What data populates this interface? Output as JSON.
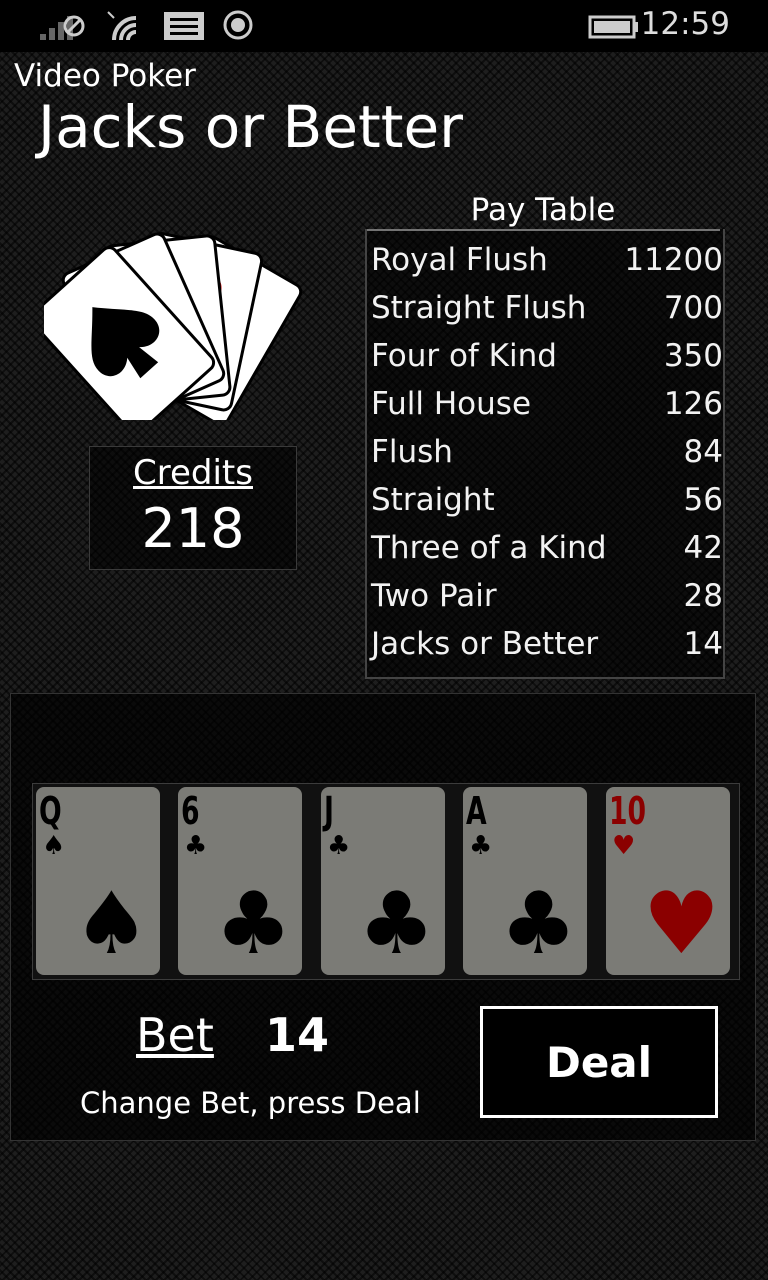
{
  "status": {
    "time": "12:59",
    "icons": [
      "signal-icon",
      "wifi-icon",
      "message-icon",
      "location-icon",
      "battery-icon"
    ]
  },
  "app": {
    "name": "Video Poker",
    "title": "Jacks or Better"
  },
  "credits": {
    "label": "Credits",
    "value": "218"
  },
  "paytable": {
    "title": "Pay Table",
    "rows": [
      {
        "hand": "Royal Flush",
        "payout": "11200"
      },
      {
        "hand": "Straight Flush",
        "payout": "700"
      },
      {
        "hand": "Four of Kind",
        "payout": "350"
      },
      {
        "hand": "Full House",
        "payout": "126"
      },
      {
        "hand": "Flush",
        "payout": "84"
      },
      {
        "hand": "Straight",
        "payout": "56"
      },
      {
        "hand": "Three of a Kind",
        "payout": "42"
      },
      {
        "hand": "Two Pair",
        "payout": "28"
      },
      {
        "hand": "Jacks or Better",
        "payout": "14"
      }
    ]
  },
  "hand": [
    {
      "rank": "Q",
      "suit": "♠",
      "color": "#000000"
    },
    {
      "rank": "6",
      "suit": "♣",
      "color": "#000000"
    },
    {
      "rank": "J",
      "suit": "♣",
      "color": "#000000"
    },
    {
      "rank": "A",
      "suit": "♣",
      "color": "#000000"
    },
    {
      "rank": "10",
      "suit": "♥",
      "color": "#8b0000"
    }
  ],
  "bet": {
    "label": "Bet",
    "value": "14",
    "hint": "Change Bet, press Deal"
  },
  "deal_button": {
    "label": "Deal"
  }
}
